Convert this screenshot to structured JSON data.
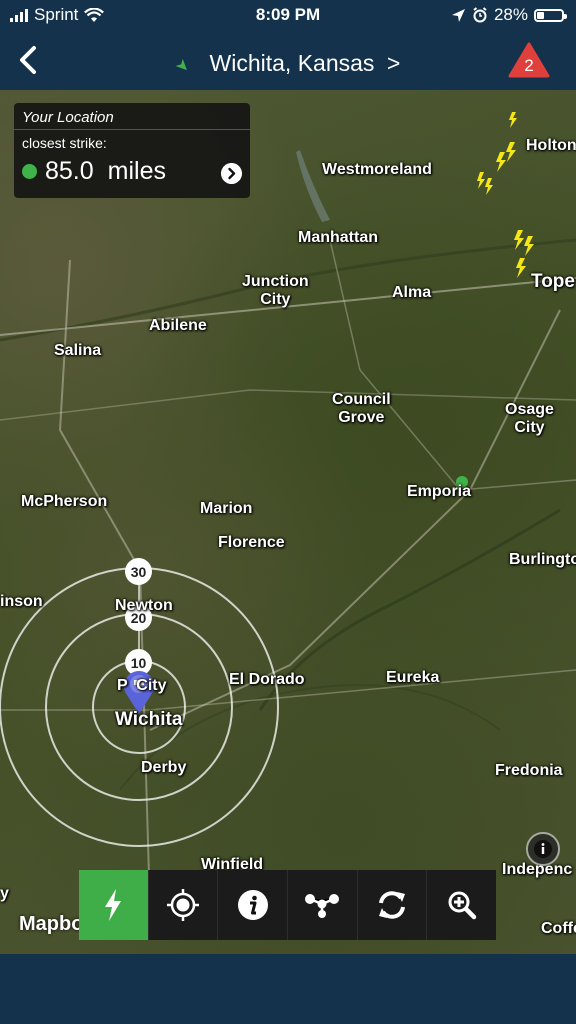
{
  "status": {
    "carrier": "Sprint",
    "time": "8:09 PM",
    "battery": "28%",
    "battery_level": 0.28
  },
  "nav": {
    "title": "Wichita, Kansas",
    "title_chevron": ">",
    "alert_count": "2"
  },
  "info": {
    "header": "Your Location",
    "label": "closest strike:",
    "distance": "85.0",
    "unit": "miles",
    "dot_color": "#3fb24a"
  },
  "map": {
    "places": {
      "holton": "Holton",
      "westmoreland": "Westmoreland",
      "manhattan": "Manhattan",
      "junction_city": "Junction\nCity",
      "alma": "Alma",
      "topeka": "Tope",
      "abilene": "Abilene",
      "salina": "Salina",
      "council_grove": "Council\nGrove",
      "osage_city": "Osage\nCity",
      "emporia": "Emporia",
      "mcpherson": "McPherson",
      "marion": "Marion",
      "florence": "Florence",
      "burlington": "Burlingto",
      "hutchinson": "inson",
      "newton": "Newton",
      "park_city": "P  City",
      "el_dorado": "El Dorado",
      "eureka": "Eureka",
      "wichita": "Wichita",
      "derby": "Derby",
      "fredonia": "Fredonia",
      "winfield": "Winfield",
      "independence": "Indepenc",
      "coffeyville": "Coffe",
      "edge_y": "y"
    },
    "rings": [
      "30",
      "20",
      "10"
    ],
    "attribution": "Mapbox"
  },
  "toolbar": {
    "buttons": [
      {
        "name": "lightning",
        "icon": "lightning-icon",
        "active": true
      },
      {
        "name": "locate",
        "icon": "crosshair-icon",
        "active": false
      },
      {
        "name": "info",
        "icon": "info-icon",
        "active": false
      },
      {
        "name": "share",
        "icon": "share-network-icon",
        "active": false
      },
      {
        "name": "refresh",
        "icon": "refresh-icon",
        "active": false
      },
      {
        "name": "zoom",
        "icon": "zoom-icon",
        "active": false
      }
    ]
  },
  "colors": {
    "bar": "#14324c",
    "accent": "#3fae48",
    "alert": "#e0403c",
    "strike": "#f5e616"
  }
}
